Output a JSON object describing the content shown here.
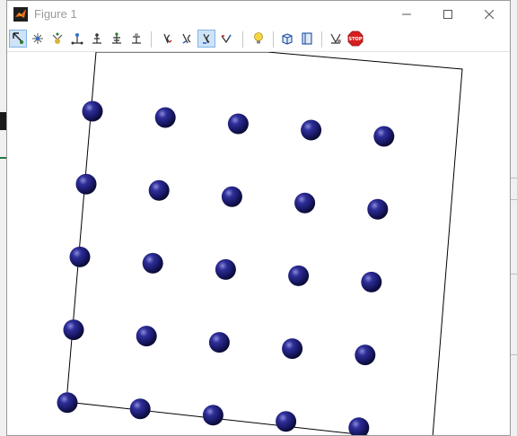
{
  "window": {
    "title": "Figure 1",
    "accent_color": "#cfe3f7"
  },
  "toolbar": {
    "buttons": [
      {
        "icon": "select-arrow-icon",
        "pressed": true
      },
      {
        "icon": "select-point-icon"
      },
      {
        "icon": "select-atom-icon"
      },
      {
        "icon": "label-distance-icon"
      },
      {
        "icon": "label-angle-icon"
      },
      {
        "icon": "label-dihedral-icon"
      },
      {
        "icon": "label-plane-icon"
      },
      {
        "icon": "rotate-x-icon"
      },
      {
        "icon": "rotate-y-icon"
      },
      {
        "icon": "rotate-z-icon",
        "pressed": true
      },
      {
        "icon": "rotate-free-icon"
      },
      {
        "icon": "light-bulb-icon"
      },
      {
        "icon": "cube-3d-icon"
      },
      {
        "icon": "book-icon"
      },
      {
        "icon": "atom-settings-icon"
      },
      {
        "icon": "stop-icon",
        "label": "STOP"
      }
    ]
  },
  "scene": {
    "atom_color": "#1c1c6e",
    "atom_highlight": "#8a8ad8",
    "frame_color": "#000000",
    "lattice_rows": 5,
    "lattice_cols": 5
  }
}
